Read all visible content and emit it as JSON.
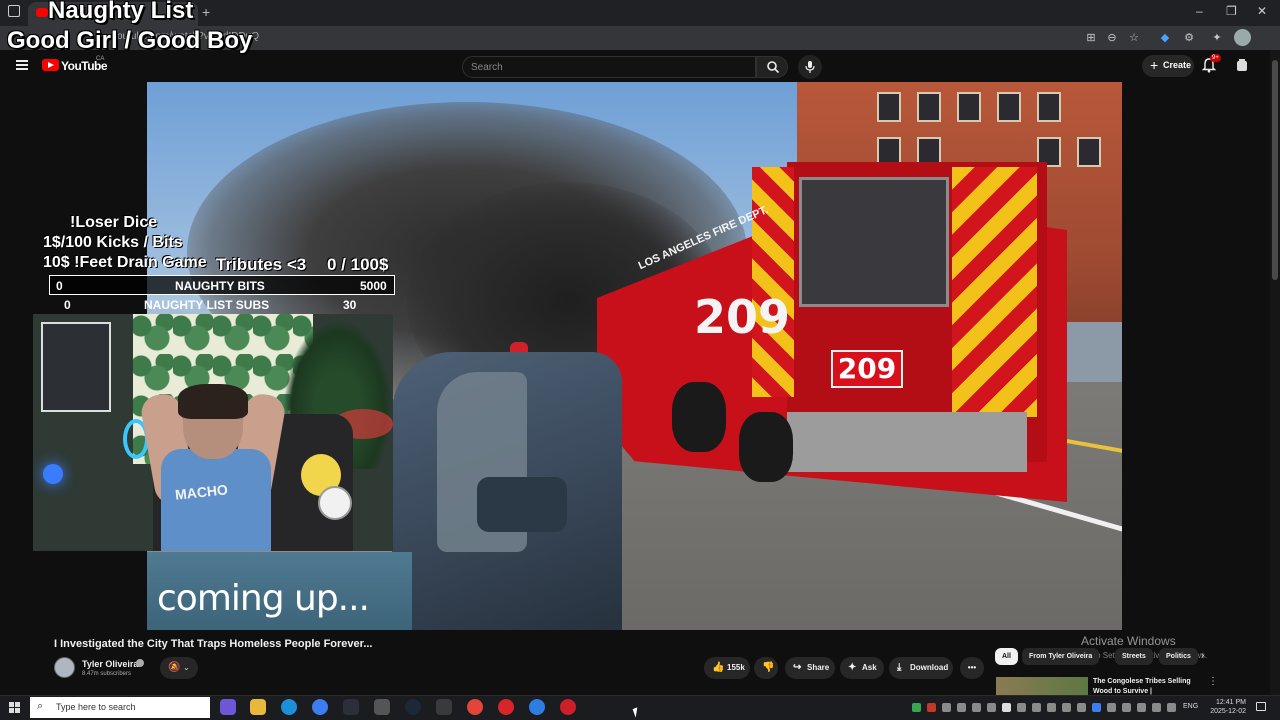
{
  "browser": {
    "tab_title": "",
    "new_tab_label": "+",
    "url": "youtube.com/watch?v=...dIDDuQ",
    "window_controls": [
      "–",
      "❐",
      "✕"
    ]
  },
  "overlay": {
    "title": "Naughty List",
    "subtitle": "Good Girl / Good Boy",
    "line1": "!Loser Dice",
    "line2": "1$/100 Kicks / Bits",
    "line3": "10$ !Feet Drain Game",
    "tribute_label": "Tributes <3",
    "tribute_value": "0 / 100$",
    "bits_left": "0",
    "bits_label": "NAUGHTY BITS",
    "bits_right": "5000",
    "subs_left": "0",
    "subs_label": "NAUGHTY LIST SUBS",
    "subs_right": "30",
    "shirt_text": "MACHO"
  },
  "youtube": {
    "logo_text": "YouTube",
    "country": "CA",
    "search_placeholder": "Search",
    "create_label": "Create",
    "notification_badge": "9+"
  },
  "video": {
    "truck_number": "209",
    "truck_text": "LOS ANGELES FIRE DEPT.",
    "caption": "coming up...",
    "title": "I Investigated the City That Traps Homeless People Forever...",
    "channel": "Tyler Oliveira",
    "subscribers": "8.47m subscribers",
    "likes": "155k",
    "share_label": "Share",
    "ask_label": "Ask",
    "download_label": "Download",
    "more_label": "•••"
  },
  "chips": [
    "All",
    "From Tyler Oliveira",
    "Streets",
    "Politics"
  ],
  "recommendation": {
    "title": "The Congolese Tribes Selling Wood to Survive |"
  },
  "windows_watermark": {
    "title": "Activate Windows",
    "subtitle": "Go to Settings to activate Windows."
  },
  "taskbar": {
    "search_placeholder": "Type here to search",
    "language": "ENG",
    "time": "12:41 PM",
    "date": "2025-12-02"
  }
}
